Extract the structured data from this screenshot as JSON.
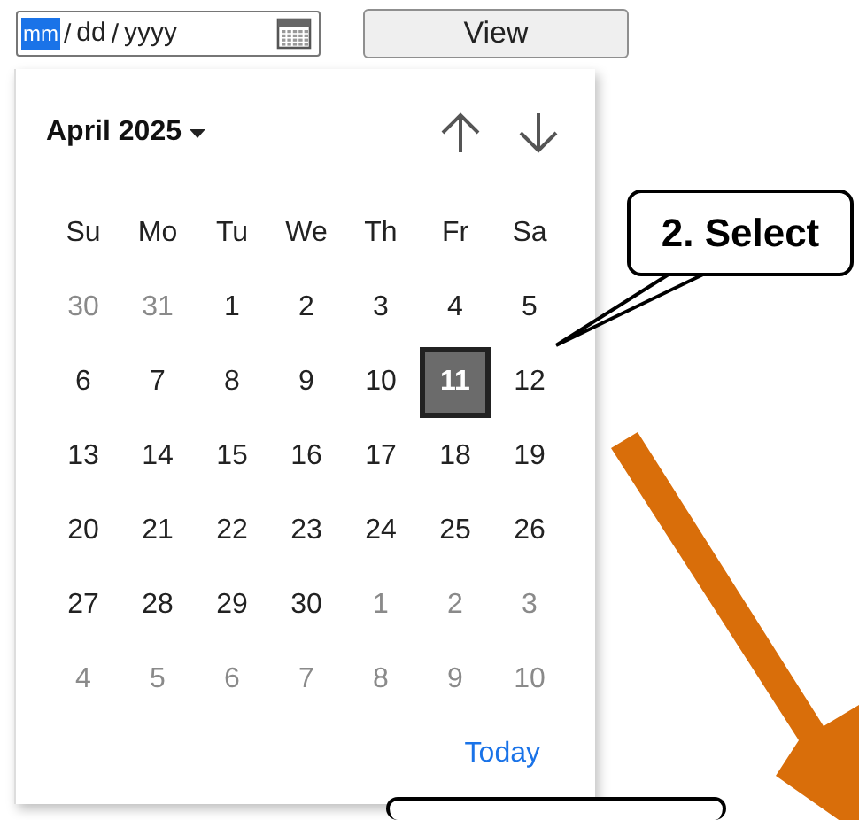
{
  "date_input": {
    "segments": [
      {
        "label": "mm",
        "selected": true
      },
      {
        "label": "dd",
        "selected": false
      },
      {
        "label": "yyyy",
        "selected": false
      }
    ],
    "separator": "/"
  },
  "view_button": "View",
  "calendar": {
    "month": "April 2025",
    "weekdays": [
      "Su",
      "Mo",
      "Tu",
      "We",
      "Th",
      "Fr",
      "Sa"
    ],
    "weeks": [
      [
        {
          "label": "30",
          "in_month": false,
          "selected": false
        },
        {
          "label": "31",
          "in_month": false,
          "selected": false
        },
        {
          "label": "1",
          "in_month": true,
          "selected": false
        },
        {
          "label": "2",
          "in_month": true,
          "selected": false
        },
        {
          "label": "3",
          "in_month": true,
          "selected": false
        },
        {
          "label": "4",
          "in_month": true,
          "selected": false
        },
        {
          "label": "5",
          "in_month": true,
          "selected": false
        }
      ],
      [
        {
          "label": "6",
          "in_month": true,
          "selected": false
        },
        {
          "label": "7",
          "in_month": true,
          "selected": false
        },
        {
          "label": "8",
          "in_month": true,
          "selected": false
        },
        {
          "label": "9",
          "in_month": true,
          "selected": false
        },
        {
          "label": "10",
          "in_month": true,
          "selected": false
        },
        {
          "label": "11",
          "in_month": true,
          "selected": true
        },
        {
          "label": "12",
          "in_month": true,
          "selected": false
        }
      ],
      [
        {
          "label": "13",
          "in_month": true,
          "selected": false
        },
        {
          "label": "14",
          "in_month": true,
          "selected": false
        },
        {
          "label": "15",
          "in_month": true,
          "selected": false
        },
        {
          "label": "16",
          "in_month": true,
          "selected": false
        },
        {
          "label": "17",
          "in_month": true,
          "selected": false
        },
        {
          "label": "18",
          "in_month": true,
          "selected": false
        },
        {
          "label": "19",
          "in_month": true,
          "selected": false
        }
      ],
      [
        {
          "label": "20",
          "in_month": true,
          "selected": false
        },
        {
          "label": "21",
          "in_month": true,
          "selected": false
        },
        {
          "label": "22",
          "in_month": true,
          "selected": false
        },
        {
          "label": "23",
          "in_month": true,
          "selected": false
        },
        {
          "label": "24",
          "in_month": true,
          "selected": false
        },
        {
          "label": "25",
          "in_month": true,
          "selected": false
        },
        {
          "label": "26",
          "in_month": true,
          "selected": false
        }
      ],
      [
        {
          "label": "27",
          "in_month": true,
          "selected": false
        },
        {
          "label": "28",
          "in_month": true,
          "selected": false
        },
        {
          "label": "29",
          "in_month": true,
          "selected": false
        },
        {
          "label": "30",
          "in_month": true,
          "selected": false
        },
        {
          "label": "1",
          "in_month": false,
          "selected": false
        },
        {
          "label": "2",
          "in_month": false,
          "selected": false
        },
        {
          "label": "3",
          "in_month": false,
          "selected": false
        }
      ],
      [
        {
          "label": "4",
          "in_month": false,
          "selected": false
        },
        {
          "label": "5",
          "in_month": false,
          "selected": false
        },
        {
          "label": "6",
          "in_month": false,
          "selected": false
        },
        {
          "label": "7",
          "in_month": false,
          "selected": false
        },
        {
          "label": "8",
          "in_month": false,
          "selected": false
        },
        {
          "label": "9",
          "in_month": false,
          "selected": false
        },
        {
          "label": "10",
          "in_month": false,
          "selected": false
        }
      ]
    ],
    "today": "Today"
  },
  "annotations": [
    {
      "kind": "callout",
      "text": "2. Select"
    },
    {
      "kind": "arrow"
    },
    {
      "kind": "box"
    }
  ]
}
